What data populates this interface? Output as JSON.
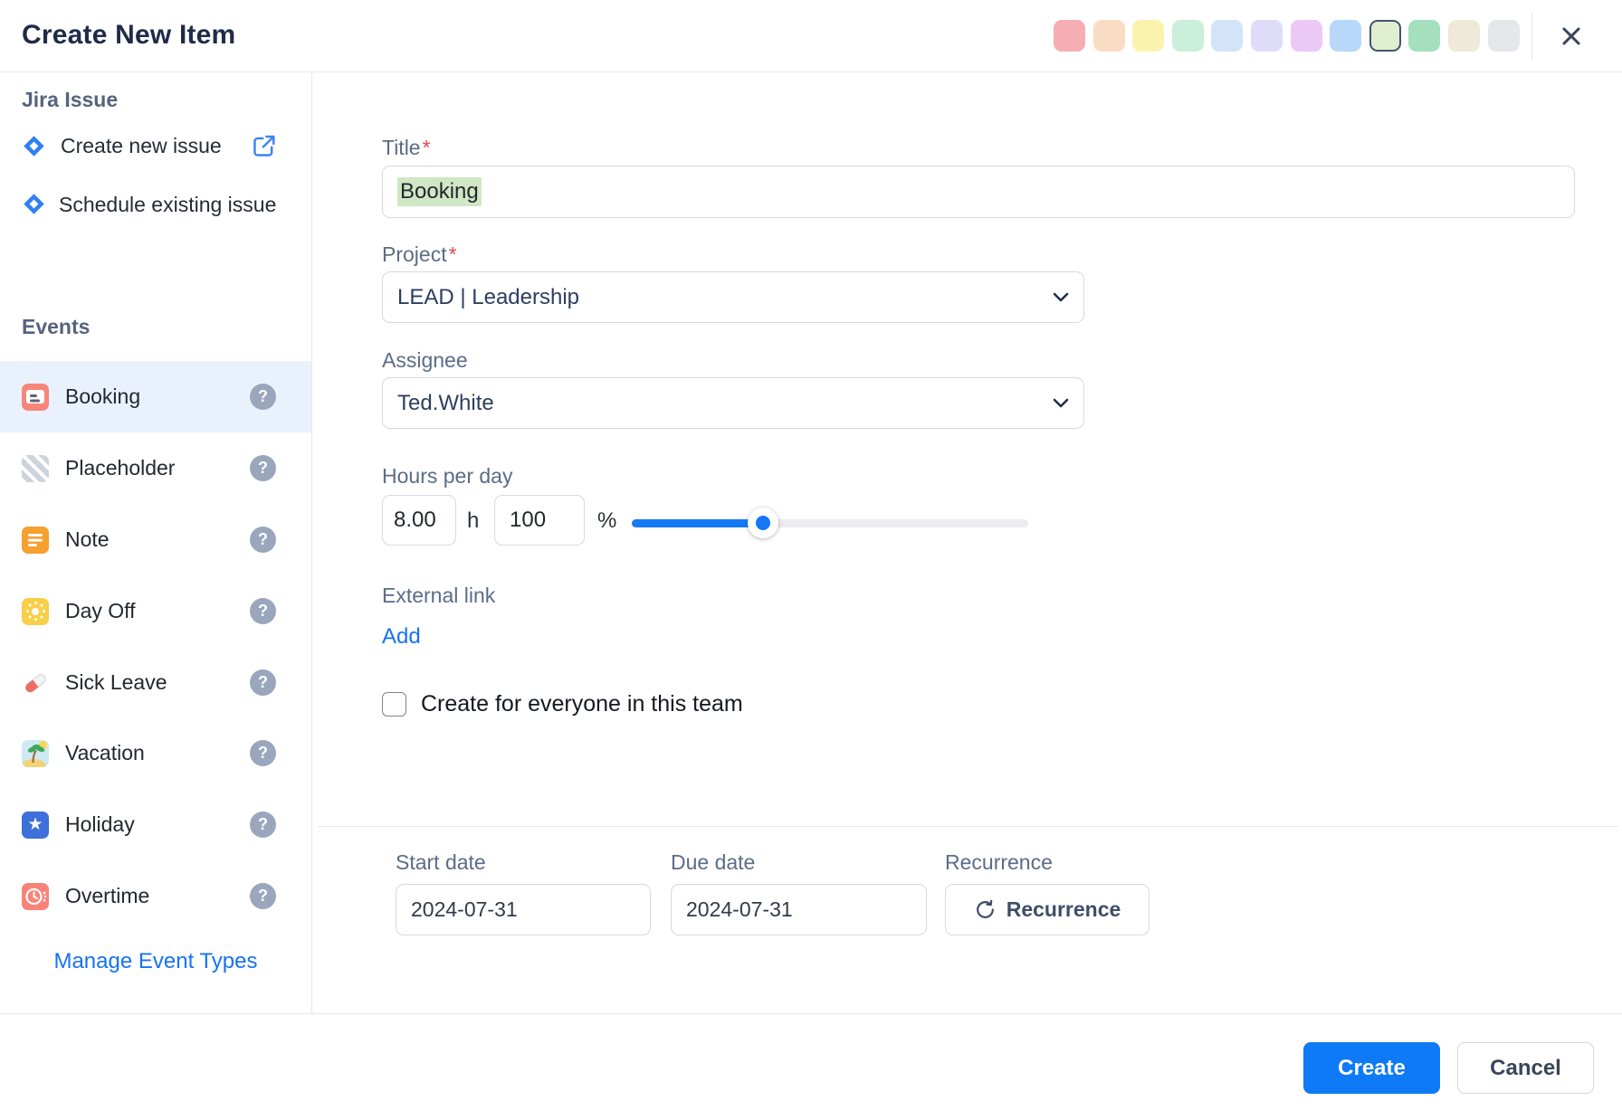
{
  "ui": {
    "required_mark": "*",
    "icons": {
      "help_glyph": "?",
      "star_glyph": "★",
      "jira": "jira-diamond-icon",
      "external_link": "open-in-new-icon",
      "close": "x-icon",
      "chevron": "chevron-down-icon",
      "recurrence": "circular-arrow-icon"
    }
  },
  "theme": {
    "link": "#1672f6",
    "primary_button": "#0e7af6",
    "title_highlight": "#cfe7c4",
    "selected_row_bg": "#e9f2fc"
  },
  "header": {
    "title": "Create New Item",
    "colors": [
      "#f6aeb2",
      "#f9dcc4",
      "#fbf2ae",
      "#c9efda",
      "#d3e3f8",
      "#dedcf9",
      "#ecc8f6",
      "#b7d8f8",
      "#e0efcf",
      "#a4e0bd",
      "#efe9da",
      "#e6e7ea"
    ],
    "selected_index": 8
  },
  "sidebar": {
    "jira": {
      "heading": "Jira Issue",
      "create_new": "Create new issue",
      "schedule_existing": "Schedule existing issue"
    },
    "events": {
      "heading": "Events",
      "selected_index": 0,
      "items": [
        {
          "label": "Booking",
          "icon": "booking-card-icon"
        },
        {
          "label": "Placeholder",
          "icon": "striped-placeholder-icon"
        },
        {
          "label": "Note",
          "icon": "note-lines-icon"
        },
        {
          "label": "Day Off",
          "icon": "sun-icon"
        },
        {
          "label": "Sick Leave",
          "icon": "pill-icon"
        },
        {
          "label": "Vacation",
          "icon": "palm-island-icon"
        },
        {
          "label": "Holiday",
          "icon": "star-icon"
        },
        {
          "label": "Overtime",
          "icon": "clock-icon"
        }
      ]
    },
    "manage_link": "Manage Event Types"
  },
  "form": {
    "title": {
      "label": "Title",
      "required": true,
      "value": "Booking"
    },
    "project": {
      "label": "Project",
      "required": true,
      "value": "LEAD | Leadership"
    },
    "assignee": {
      "label": "Assignee",
      "value": "Ted.White"
    },
    "hours": {
      "label": "Hours per day",
      "hours_value": "8.00",
      "hours_unit": "h",
      "percent_value": "100",
      "percent_unit": "%",
      "slider_percent": 33
    },
    "external_link": {
      "label": "External link",
      "add_label": "Add"
    },
    "team": {
      "label": "Create for everyone in this team",
      "checked": false
    },
    "dates": {
      "start": {
        "label": "Start date",
        "value": "2024-07-31"
      },
      "due": {
        "label": "Due date",
        "value": "2024-07-31"
      },
      "recurrence": {
        "label": "Recurrence",
        "button_label": "Recurrence"
      }
    }
  },
  "footer": {
    "create_label": "Create",
    "cancel_label": "Cancel"
  }
}
